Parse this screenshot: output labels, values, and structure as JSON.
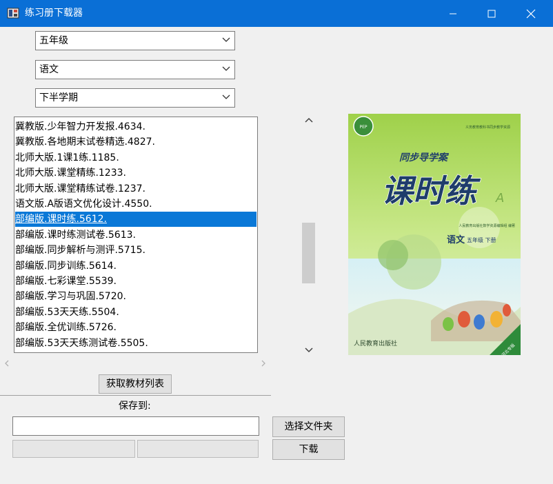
{
  "window": {
    "title": "练习册下载器"
  },
  "filters": {
    "grade": "五年级",
    "subject": "语文",
    "term": "下半学期"
  },
  "book_list": {
    "selected_index": 6,
    "items": [
      "冀教版.少年智力开发报.4634.",
      "冀教版.各地期末试卷精选.4827.",
      "北师大版.1课1练.1185.",
      "北师大版.课堂精练.1233.",
      "北师大版.课堂精练试卷.1237.",
      "语文版.A版语文优化设计.4550.",
      "部编版.课时练.5612.",
      "部编版.课时练测试卷.5613.",
      "部编版.同步解析与测评.5715.",
      "部编版.同步训练.5614.",
      "部编版.七彩课堂.5539.",
      "部编版.学习与巩固.5720.",
      "部编版.53天天练.5504.",
      "部编版.全优训练.5726.",
      "部编版.53天天练测试卷.5505."
    ]
  },
  "cover": {
    "series_top": "义务教育教科书同步教学资源",
    "brand": "同步导学案",
    "title": "课时练",
    "letter": "A",
    "editor_line": "人民教育出版社数学资源编辑组  编著",
    "subject": "语文",
    "grade_term": "五年级 下册",
    "publisher": "人民教育出版社",
    "badge": "河北专版",
    "accent_color": "#8dc63f"
  },
  "buttons": {
    "get_list": "获取教材列表",
    "choose_folder": "选择文件夹",
    "download": "下载"
  },
  "save": {
    "label": "保存到:",
    "path": ""
  }
}
